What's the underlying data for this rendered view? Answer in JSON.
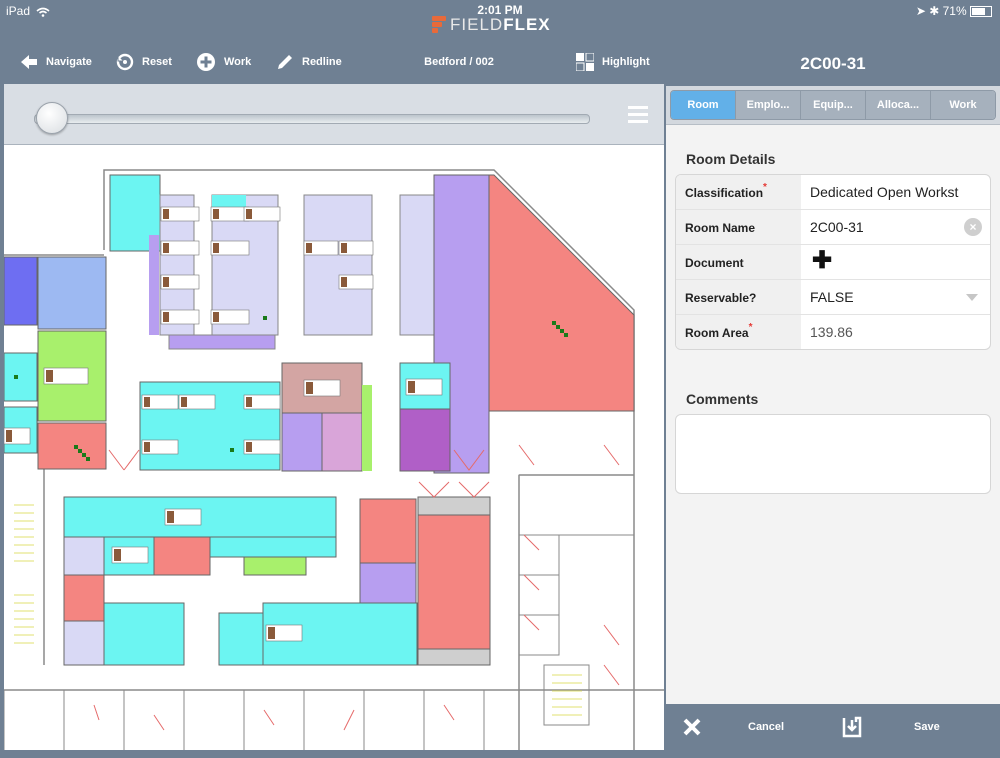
{
  "status_bar": {
    "device": "iPad",
    "time": "2:01 PM",
    "battery": "71%"
  },
  "app": {
    "logo_part1": "FIELD",
    "logo_part2": "FLEX"
  },
  "toolbar": {
    "navigate": "Navigate",
    "reset": "Reset",
    "work": "Work",
    "redline": "Redline",
    "location": "Bedford / 002",
    "highlight": "Highlight"
  },
  "slider": {
    "value_fraction": 0.0
  },
  "panel": {
    "title": "2C00-31",
    "tabs": [
      "Room",
      "Emplo...",
      "Equip...",
      "Alloca...",
      "Work"
    ],
    "active_tab": "Room",
    "details_title": "Room Details",
    "fields": {
      "classification_label": "Classification",
      "classification_value": "Dedicated Open Workst",
      "room_name_label": "Room Name",
      "room_name_value": "2C00-31",
      "document_label": "Document",
      "reservable_label": "Reservable?",
      "reservable_value": "FALSE",
      "room_area_label": "Room Area",
      "room_area_value": "139.86"
    },
    "comments_title": "Comments",
    "footer": {
      "cancel": "Cancel",
      "save": "Save"
    }
  },
  "colors": {
    "chrome": "#6f8093",
    "active_tab": "#62b0e8",
    "cyan_room": "#6cf5f2",
    "salmon_room": "#f48581",
    "purple_room": "#b79ef0",
    "lavender_room": "#d9d9f5",
    "green_room": "#a8f06c",
    "blue_room": "#6e6ef2"
  }
}
